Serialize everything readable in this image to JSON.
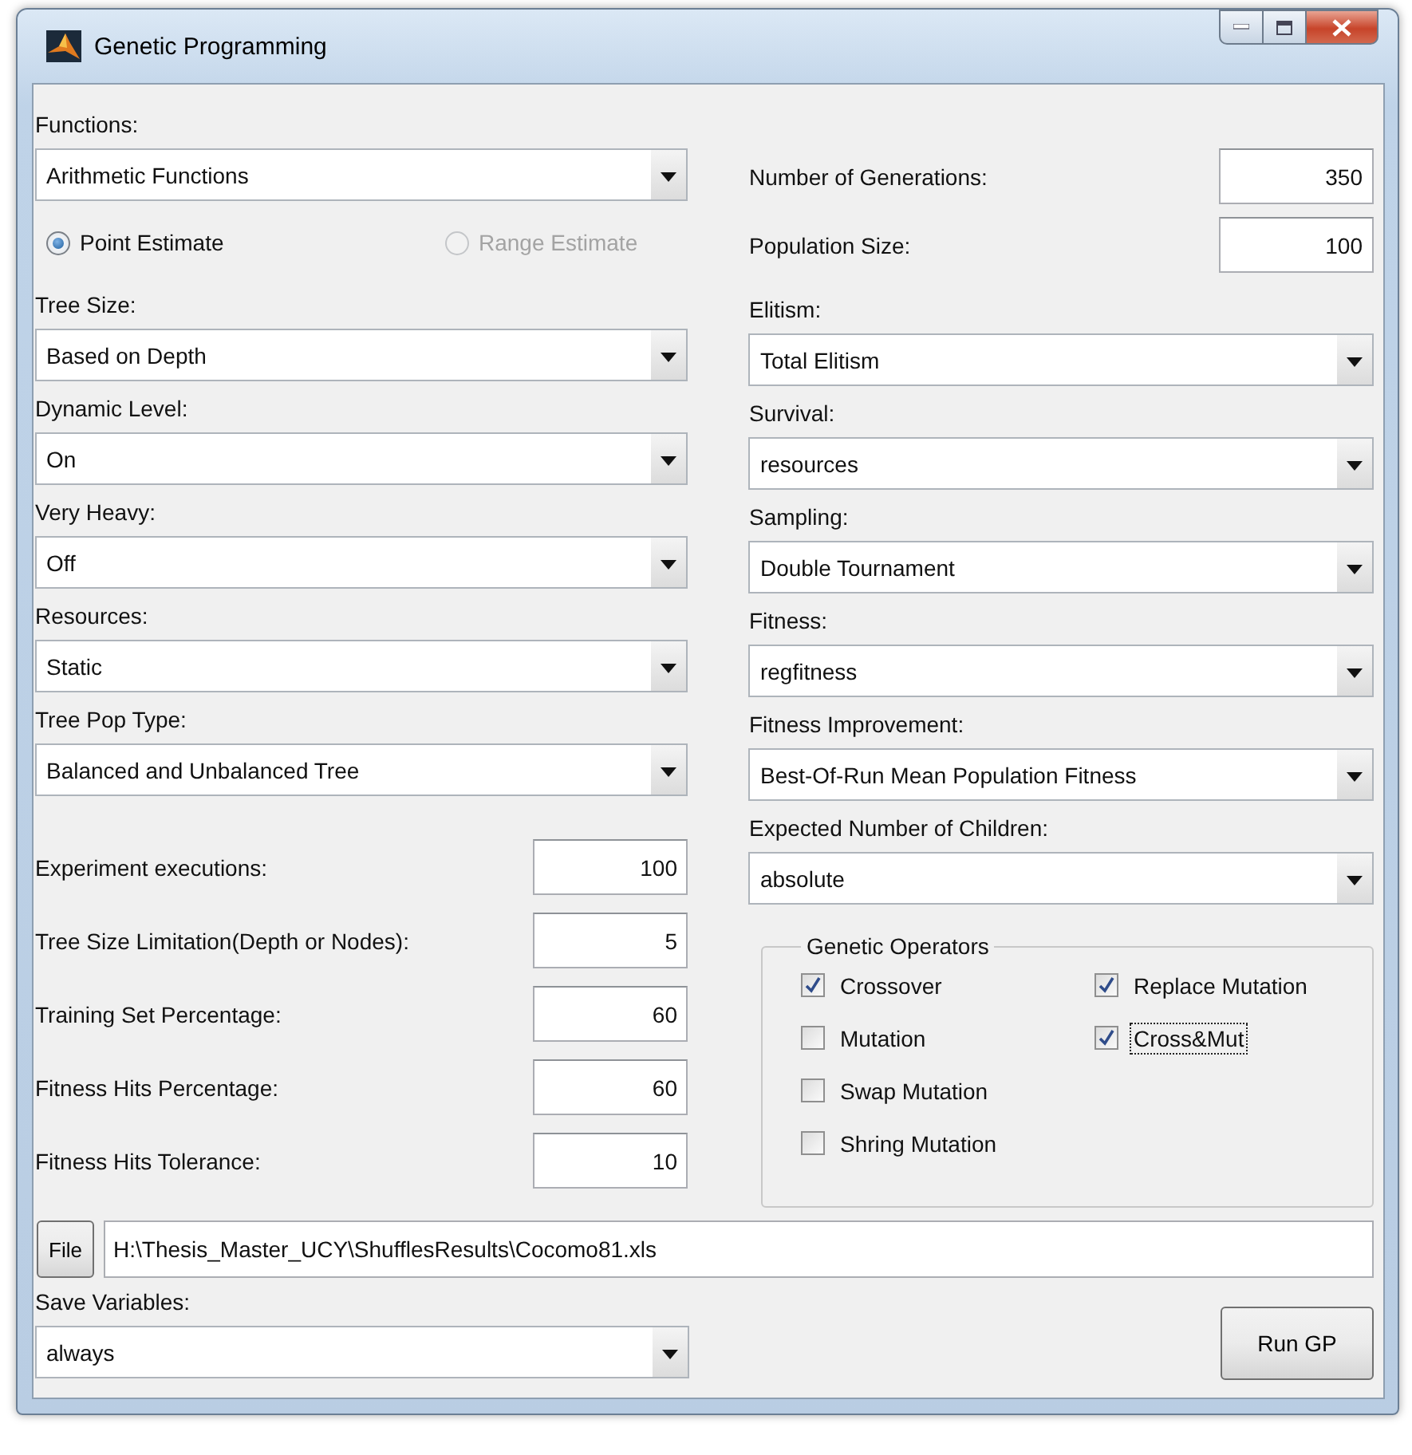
{
  "window": {
    "title": "Genetic Programming"
  },
  "left": {
    "functions": {
      "label": "Functions:",
      "value": "Arithmetic Functions"
    },
    "estimate": [
      {
        "label": "Point Estimate",
        "selected": true,
        "disabled": false
      },
      {
        "label": "Range Estimate",
        "selected": false,
        "disabled": true
      }
    ],
    "dropdowns": [
      {
        "label": "Tree Size:",
        "value": "Based on Depth"
      },
      {
        "label": "Dynamic Level:",
        "value": "On"
      },
      {
        "label": "Very Heavy:",
        "value": "Off"
      },
      {
        "label": "Resources:",
        "value": "Static"
      },
      {
        "label": "Tree Pop Type:",
        "value": "Balanced and Unbalanced Tree"
      }
    ],
    "numeric_fields": [
      {
        "label": "Experiment executions:",
        "value": "100"
      },
      {
        "label": "Tree Size Limitation(Depth or Nodes):",
        "value": "5"
      },
      {
        "label": "Training Set Percentage:",
        "value": "60"
      },
      {
        "label": "Fitness Hits Percentage:",
        "value": "60"
      },
      {
        "label": "Fitness Hits Tolerance:",
        "value": "10"
      }
    ]
  },
  "right": {
    "numeric_fields": [
      {
        "label": "Number of Generations:",
        "value": "350"
      },
      {
        "label": "Population Size:",
        "value": "100"
      }
    ],
    "dropdowns": [
      {
        "label": "Elitism:",
        "value": "Total Elitism"
      },
      {
        "label": "Survival:",
        "value": "resources"
      },
      {
        "label": "Sampling:",
        "value": "Double Tournament"
      },
      {
        "label": "Fitness:",
        "value": "regfitness"
      },
      {
        "label": "Fitness Improvement:",
        "value": "Best-Of-Run Mean Population Fitness"
      },
      {
        "label": "Expected Number of Children:",
        "value": "absolute"
      }
    ],
    "genetic_operators": {
      "title": "Genetic Operators",
      "columns": [
        [
          {
            "label": "Crossover",
            "checked": true,
            "focused": false
          },
          {
            "label": "Mutation",
            "checked": false,
            "focused": false
          },
          {
            "label": "Swap Mutation",
            "checked": false,
            "focused": false
          },
          {
            "label": "Shring Mutation",
            "checked": false,
            "focused": false
          }
        ],
        [
          {
            "label": "Replace Mutation",
            "checked": true,
            "focused": false
          },
          {
            "label": "Cross&Mut",
            "checked": true,
            "focused": true
          }
        ]
      ]
    }
  },
  "file": {
    "button": "File",
    "path": "H:\\Thesis_Master_UCY\\ShufflesResults\\Cocomo81.xls"
  },
  "save_variables": {
    "label": "Save Variables:",
    "value": "always"
  },
  "run_button": "Run GP"
}
